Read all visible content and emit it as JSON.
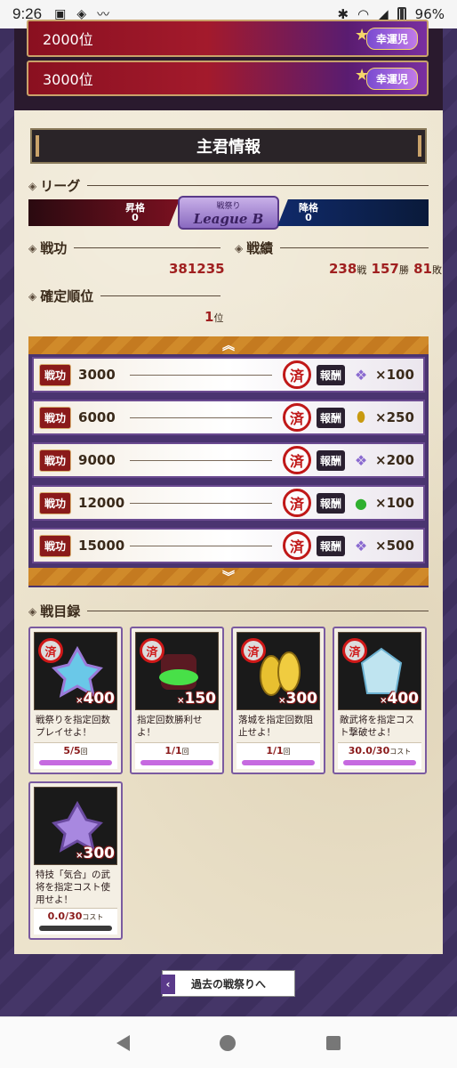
{
  "statusbar": {
    "time": "9:26",
    "battery": "96%"
  },
  "rank_banners": [
    {
      "rank": "2000位",
      "badge": "幸運児"
    },
    {
      "rank": "3000位",
      "badge": "幸運児"
    }
  ],
  "section_title": "主君情報",
  "league": {
    "label": "リーグ",
    "promote_label": "昇格",
    "promote_count": "0",
    "current_top": "戦祭り",
    "current_name": "League B",
    "demote_label": "降格",
    "demote_count": "0"
  },
  "senko": {
    "label": "戦功",
    "value": "381235"
  },
  "record": {
    "label": "戦績",
    "battles": "238",
    "battles_unit": "戦",
    "wins": "157",
    "wins_unit": "勝",
    "losses": "81",
    "losses_unit": "敗"
  },
  "fixed_rank": {
    "label": "確定順位",
    "value": "1",
    "unit": "位"
  },
  "rewards": [
    {
      "tag": "戦功",
      "points": "3000",
      "stamp": "済",
      "reward_tag": "報酬",
      "icon": "crystal-icon",
      "qty": "×100"
    },
    {
      "tag": "戦功",
      "points": "6000",
      "stamp": "済",
      "reward_tag": "報酬",
      "icon": "gold-coin-icon",
      "qty": "×250"
    },
    {
      "tag": "戦功",
      "points": "9000",
      "stamp": "済",
      "reward_tag": "報酬",
      "icon": "crystal-icon",
      "qty": "×200"
    },
    {
      "tag": "戦功",
      "points": "12000",
      "stamp": "済",
      "reward_tag": "報酬",
      "icon": "green-pot-icon",
      "qty": "×100"
    },
    {
      "tag": "戦功",
      "points": "15000",
      "stamp": "済",
      "reward_tag": "報酬",
      "icon": "crystal-icon",
      "qty": "×500"
    }
  ],
  "missions_label": "戦目録",
  "missions": [
    {
      "stamp": "済",
      "count": "400",
      "desc": "戦祭りを指定回数プレイせよ！",
      "progress": "5/5",
      "unit": "回",
      "ratio": 1.0,
      "icon": "crystal-icon"
    },
    {
      "stamp": "済",
      "count": "150",
      "desc": "指定回数勝利せよ！",
      "progress": "1/1",
      "unit": "回",
      "ratio": 1.0,
      "icon": "green-pot-icon"
    },
    {
      "stamp": "済",
      "count": "300",
      "desc": "落城を指定回数阻止せよ！",
      "progress": "1/1",
      "unit": "回",
      "ratio": 1.0,
      "icon": "gold-coin-icon"
    },
    {
      "stamp": "済",
      "count": "400",
      "desc": "敵武将を指定コスト撃破せよ！",
      "progress": "30.0/30",
      "unit": "コスト",
      "ratio": 1.0,
      "icon": "blue-gem-icon"
    },
    {
      "stamp": "",
      "count": "300",
      "desc": "特技「気合」の武将を指定コスト使用せよ！",
      "progress": "0.0/30",
      "unit": "コスト",
      "ratio": 0.0,
      "icon": "crystal-icon"
    }
  ],
  "past_button": "過去の戦祭りへ"
}
